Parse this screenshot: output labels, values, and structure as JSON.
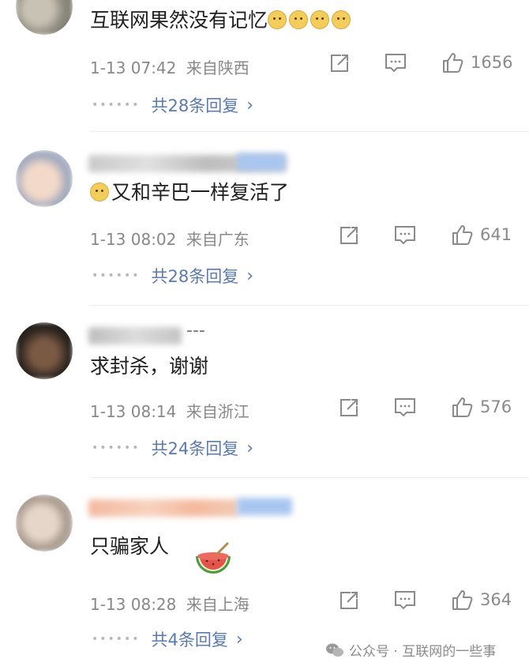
{
  "comments": [
    {
      "text": "互联网果然没有记忆",
      "emoji_suffix": [
        "doge-emoji",
        "doge-emoji",
        "doge-emoji",
        "doge-emoji"
      ],
      "time": "1-13 07:42",
      "location": "来自陕西",
      "likes": "1656",
      "replies": "共28条回复"
    },
    {
      "emoji_prefix": "doge-emoji",
      "text": "又和辛巴一样复活了",
      "time": "1-13 08:02",
      "location": "来自广东",
      "likes": "641",
      "replies": "共28条回复"
    },
    {
      "username_partial": "---",
      "text": "求封杀，谢谢",
      "time": "1-13 08:14",
      "location": "来自浙江",
      "likes": "576",
      "replies": "共24条回复"
    },
    {
      "text": "只骗家人",
      "emoji_suffix": [
        "watermelon-emoji"
      ],
      "time": "1-13 08:28",
      "location": "来自上海",
      "likes": "364",
      "replies": "共4条回复"
    }
  ],
  "watermark": {
    "label": "公众号 · 互联网的一些事"
  },
  "colors": {
    "text": "#1f1f1f",
    "meta": "#888888",
    "reply_link": "#5a7ab0",
    "divider": "#ececec"
  }
}
